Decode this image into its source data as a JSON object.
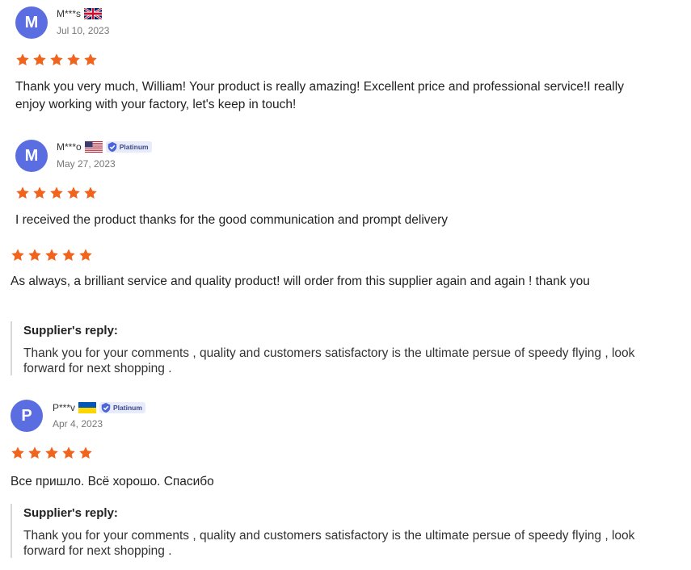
{
  "colors": {
    "avatar": "#5b6ee1",
    "star": "#f0641e",
    "badge_bg": "#e7ebfa",
    "reply_border": "#d8d8d8"
  },
  "reviews": [
    {
      "avatar_letter": "M",
      "user": "M***s",
      "flag": "uk-flag-icon",
      "date": "Jul 10, 2023",
      "rating": 5,
      "text": "Thank you very much, William! Your product is really amazing! Excellent price and professional service!I really enjoy working with your factory, let's keep in touch!"
    },
    {
      "avatar_letter": "M",
      "user": "M***o",
      "flag": "us-flag-icon",
      "badge": "Platinum",
      "date": "May 27, 2023",
      "rating": 5,
      "text": "I received the product thanks for the good communication and prompt delivery",
      "followup": {
        "rating": 5,
        "text": "As always, a brilliant service and quality product! will order from this supplier again and again ! thank you"
      },
      "reply": {
        "title": "Supplier's reply:",
        "text": "Thank you for your comments , quality and customers satisfactory is the ultimate persue of speedy flying ,  look forward for next shopping ."
      }
    },
    {
      "avatar_letter": "P",
      "user": "P***v",
      "flag": "ukraine-flag-icon",
      "badge": "Platinum",
      "date": "Apr 4, 2023",
      "rating": 5,
      "text": "Все пришло. Всё хорошо. Спасибо",
      "reply": {
        "title": "Supplier's reply:",
        "text": "Thank you for your comments , quality and customers satisfactory is the ultimate persue of speedy flying ,  look forward for next shopping ."
      }
    }
  ]
}
